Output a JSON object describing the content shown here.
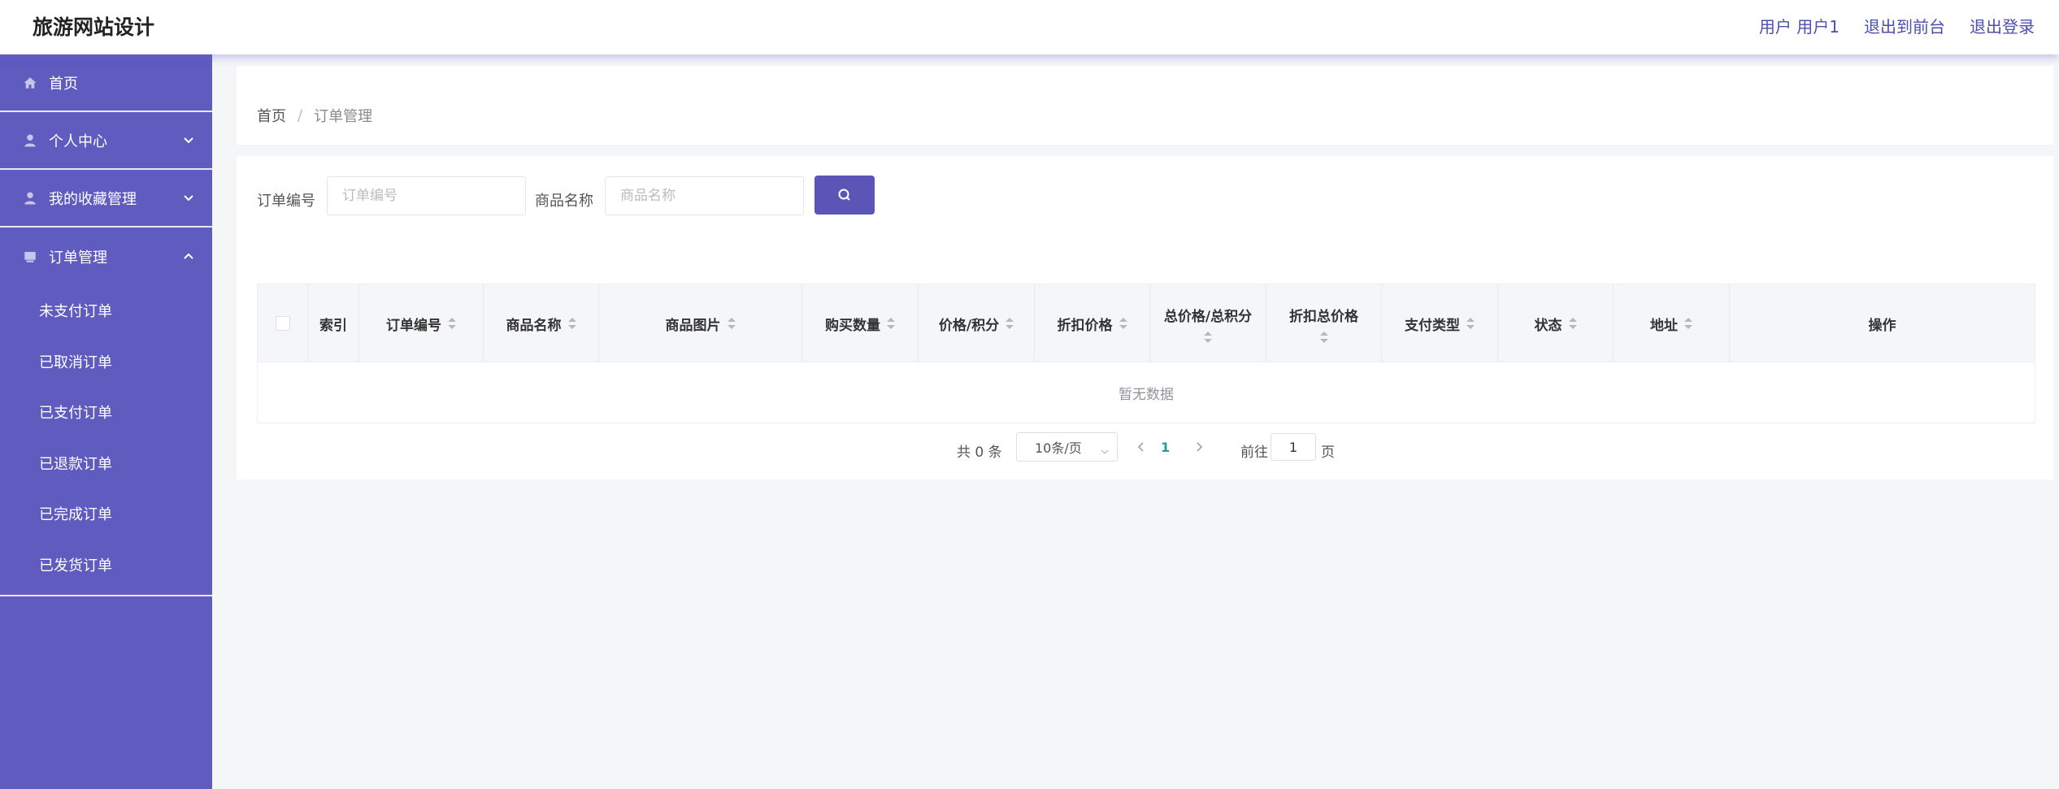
{
  "header": {
    "title": "旅游网站设计",
    "user_label": "用户 用户1",
    "frontend_link": "退出到前台",
    "logout_link": "退出登录"
  },
  "sidebar": {
    "items": [
      {
        "label": "首页",
        "icon": "home-icon"
      },
      {
        "label": "个人中心",
        "icon": "user-icon",
        "expanded": false
      },
      {
        "label": "我的收藏管理",
        "icon": "user-icon",
        "expanded": false
      },
      {
        "label": "订单管理",
        "icon": "order-icon",
        "expanded": true
      }
    ],
    "order_submenu": [
      "未支付订单",
      "已取消订单",
      "已支付订单",
      "已退款订单",
      "已完成订单",
      "已发货订单"
    ]
  },
  "breadcrumb": {
    "home": "首页",
    "separator": "/",
    "current": "订单管理"
  },
  "filters": {
    "order_no_label": "订单编号",
    "order_no_placeholder": "订单编号",
    "product_name_label": "商品名称",
    "product_name_placeholder": "商品名称"
  },
  "table": {
    "columns": {
      "index": "索引",
      "order_no": "订单编号",
      "product_name": "商品名称",
      "product_image": "商品图片",
      "quantity": "购买数量",
      "price": "价格/积分",
      "discount_price": "折扣价格",
      "total": "总价格/总积分",
      "discount_total": "折扣总价格",
      "pay_type": "支付类型",
      "status": "状态",
      "address": "地址",
      "actions": "操作"
    },
    "empty_text": "暂无数据"
  },
  "pagination": {
    "total_text": "共 0 条",
    "page_size": "10条/页",
    "current_page": "1",
    "goto_label": "前往",
    "goto_value": "1",
    "goto_suffix": "页"
  },
  "colors": {
    "sidebar_bg": "#5f5bbf",
    "accent": "#5b55b8",
    "header_link": "#4a4fb0"
  }
}
